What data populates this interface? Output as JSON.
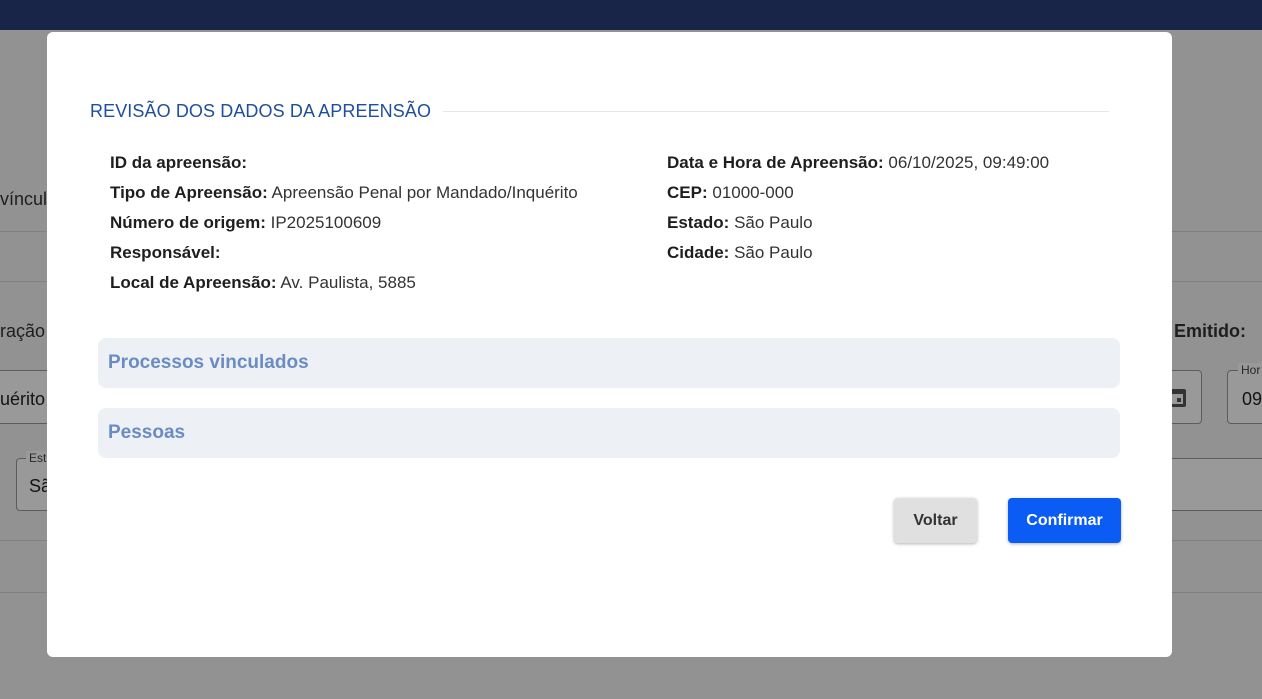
{
  "background": {
    "text_vincul": "víncul",
    "text_racao": "ração",
    "text_emitido": "o Emitido:",
    "field1_value": "uérito",
    "field2_legend": "Hor",
    "field2_value": "09",
    "field3_legend": "Est",
    "field3_value": "Sã"
  },
  "modal": {
    "section_title": "REVISÃO DOS DADOS DA APREENSÃO",
    "left_fields": [
      {
        "label": "ID da apreensão:",
        "value": ""
      },
      {
        "label": "Tipo de Apreensão:",
        "value": "Apreensão Penal por Mandado/Inquérito"
      },
      {
        "label": "Número de origem:",
        "value": "IP2025100609"
      },
      {
        "label": "Responsável:",
        "value": ""
      },
      {
        "label": "Local de Apreensão:",
        "value": "Av. Paulista, 5885"
      }
    ],
    "right_fields": [
      {
        "label": "Data e Hora de Apreensão:",
        "value": "06/10/2025, 09:49:00"
      },
      {
        "label": "CEP:",
        "value": "01000-000"
      },
      {
        "label": "Estado:",
        "value": "São Paulo"
      },
      {
        "label": "Cidade:",
        "value": "São Paulo"
      }
    ],
    "accordions": [
      {
        "label": "Processos vinculados"
      },
      {
        "label": "Pessoas"
      }
    ],
    "buttons": {
      "back": "Voltar",
      "confirm": "Confirmar"
    }
  },
  "colors": {
    "accent": "#1f4e9e",
    "primary_button": "#0a5cf5",
    "accordion_bg": "#edf0f5",
    "accordion_text": "#6b8cc3"
  }
}
